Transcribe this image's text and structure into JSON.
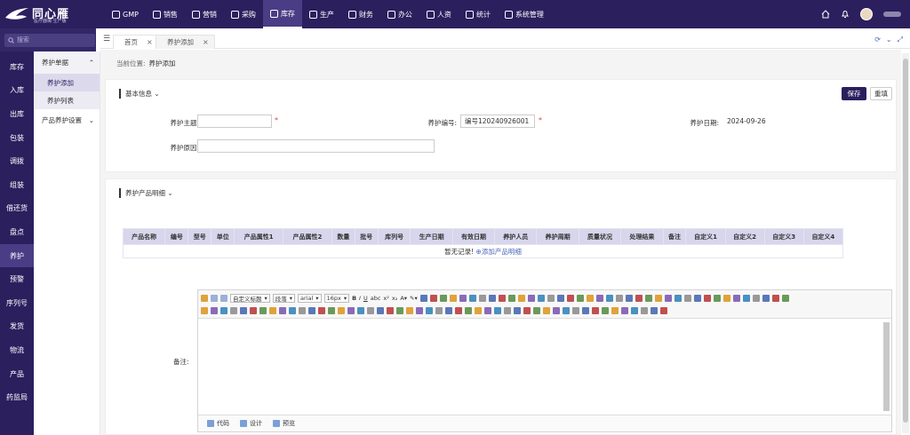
{
  "app": {
    "logo_title": "同心雁",
    "logo_sub": "医疗器械·生产版"
  },
  "topnav": [
    {
      "label": "GMP",
      "icon": "gmp-icon"
    },
    {
      "label": "销售",
      "icon": "chart-icon"
    },
    {
      "label": "营销",
      "icon": "bar-icon"
    },
    {
      "label": "采购",
      "icon": "cart-icon"
    },
    {
      "label": "库存",
      "icon": "warehouse-icon",
      "active": true
    },
    {
      "label": "生产",
      "icon": "factory-icon"
    },
    {
      "label": "财务",
      "icon": "yen-icon"
    },
    {
      "label": "办公",
      "icon": "briefcase-icon"
    },
    {
      "label": "人资",
      "icon": "user-icon"
    },
    {
      "label": "统计",
      "icon": "clock-icon"
    },
    {
      "label": "系统管理",
      "icon": "gear-icon"
    }
  ],
  "sidebar": {
    "search_placeholder": "搜索",
    "items": [
      "库存",
      "入库",
      "出库",
      "包装",
      "调拨",
      "组装",
      "借还货",
      "盘点",
      "养护",
      "预警",
      "序列号",
      "发货",
      "物流",
      "产品",
      "药监局"
    ],
    "active": "养护"
  },
  "subnav": {
    "group1": "养护单据",
    "items": [
      "养护添加",
      "养护列表"
    ],
    "group2": "产品养护设置"
  },
  "tabs": [
    {
      "label": "首页",
      "close": "×"
    },
    {
      "label": "养护添加",
      "close": "×"
    }
  ],
  "breadcrumb": {
    "prefix": "当前位置:",
    "current": "养护添加"
  },
  "basic": {
    "title": "基本信息",
    "save": "保存",
    "reset": "重填",
    "subject_label": "养护主题:",
    "subject_value": "",
    "number_label": "养护编号:",
    "number_value": "编号120240926001",
    "date_label": "养护日期:",
    "date_value": "2024-09-26",
    "reason_label": "养护原因:",
    "reason_value": "",
    "required_mark": "*"
  },
  "detail": {
    "title": "养护产品明细",
    "columns": [
      "产品名称",
      "编号",
      "型号",
      "单位",
      "产品属性1",
      "产品属性2",
      "数量",
      "批号",
      "库列号",
      "生产日期",
      "有效日期",
      "养护人员",
      "养护周期",
      "质量状况",
      "处理结果",
      "备注",
      "自定义1",
      "自定义2",
      "自定义3",
      "自定义4"
    ],
    "empty_text": "暂无记录!",
    "add_link": "添加产品明细"
  },
  "editor": {
    "label": "备注:",
    "heading_select": "自定义标题",
    "paragraph_select": "段落",
    "font_select": "arial",
    "size_select": "16px",
    "footer": [
      "代码",
      "设计",
      "预览"
    ]
  },
  "colors": {
    "brand": "#2b1f5e",
    "active_nav": "#4a3d86",
    "table_header": "#d7d6ec",
    "required": "#e03d3d",
    "link": "#4a64b8"
  }
}
